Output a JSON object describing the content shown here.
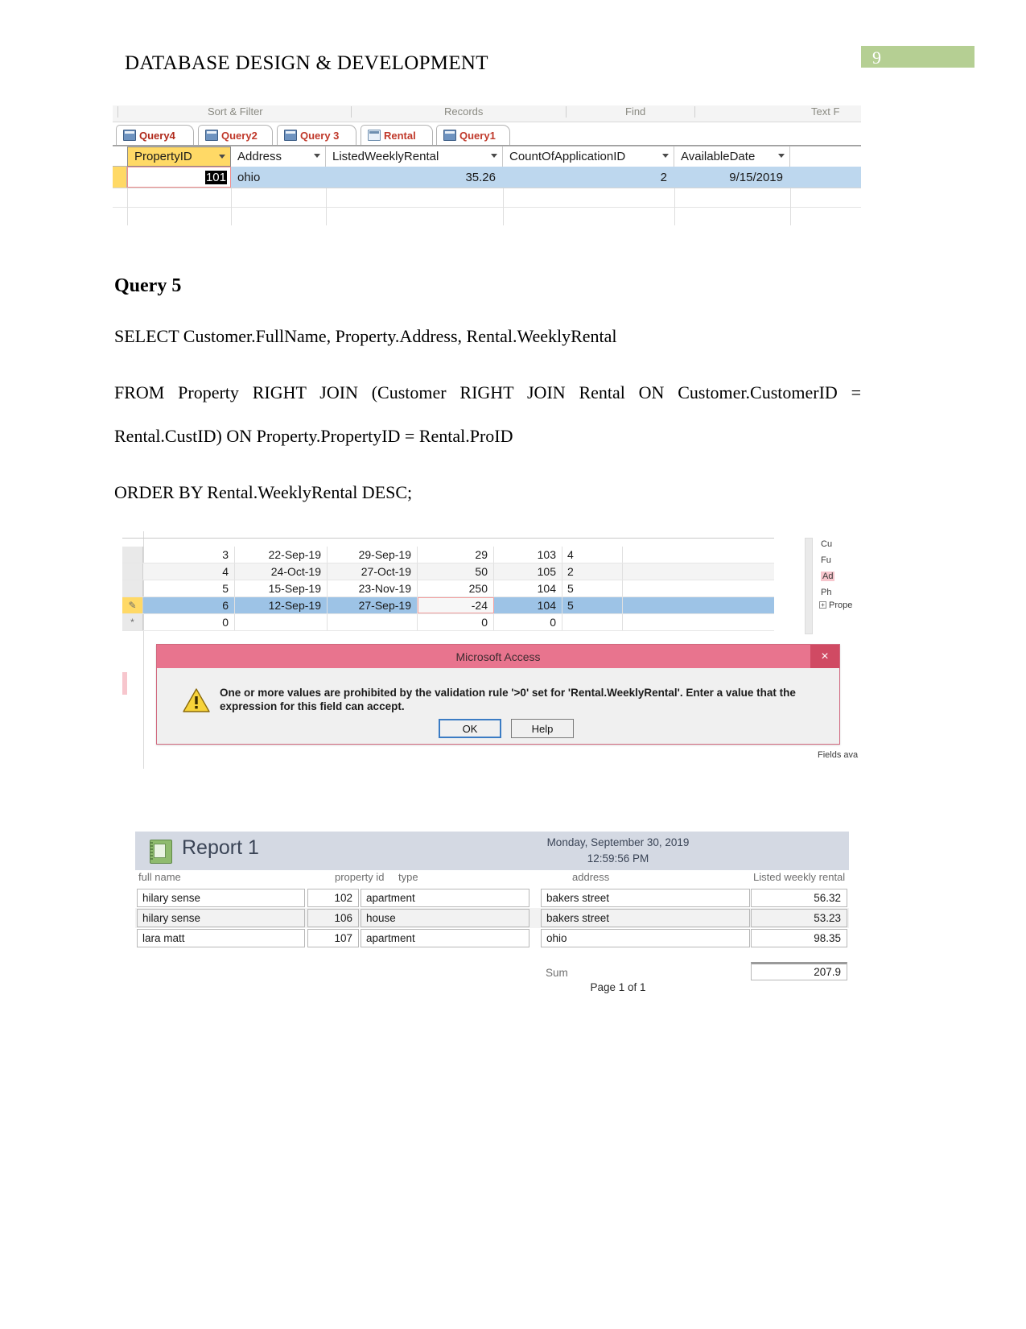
{
  "header": {
    "title": "DATABASE DESIGN & DEVELOPMENT",
    "page_number": "9",
    "accent_color": "#b5cf93"
  },
  "screenshot_query4": {
    "ribbon_groups": [
      "Sort & Filter",
      "Records",
      "Find",
      "Text F"
    ],
    "tabs": [
      {
        "label": "Query4",
        "icon": "query-icon",
        "active": true
      },
      {
        "label": "Query2",
        "icon": "query-icon",
        "active": false
      },
      {
        "label": "Query 3",
        "icon": "query-icon",
        "active": false
      },
      {
        "label": "Rental",
        "icon": "table-icon",
        "active": false
      },
      {
        "label": "Query1",
        "icon": "query-icon",
        "active": false
      }
    ],
    "columns": [
      "PropertyID",
      "Address",
      "ListedWeeklyRental",
      "CountOfApplicationID",
      "AvailableDate"
    ],
    "rows": [
      {
        "PropertyID": "101",
        "Address": "ohio",
        "ListedWeeklyRental": "35.26",
        "CountOfApplicationID": "2",
        "AvailableDate": "9/15/2019"
      }
    ]
  },
  "body": {
    "heading": "Query 5",
    "sql_line1": "SELECT Customer.FullName, Property.Address, Rental.WeeklyRental",
    "sql_line2a": "FROM Property RIGHT JOIN (Customer RIGHT JOIN Rental ON Customer.CustomerID =",
    "sql_line2b": "Rental.CustID) ON Property.PropertyID = Rental.ProID",
    "sql_line3": "ORDER BY Rental.WeeklyRental DESC;"
  },
  "screenshot_validation": {
    "grid_rows": [
      {
        "id": "3",
        "start": "22-Sep-19",
        "end": "29-Sep-19",
        "rent": "29",
        "prop": "103",
        "cust": "4",
        "selected": false,
        "alt": false,
        "invalid": false
      },
      {
        "id": "4",
        "start": "24-Oct-19",
        "end": "27-Oct-19",
        "rent": "50",
        "prop": "105",
        "cust": "2",
        "selected": false,
        "alt": true,
        "invalid": false
      },
      {
        "id": "5",
        "start": "15-Sep-19",
        "end": "23-Nov-19",
        "rent": "250",
        "prop": "104",
        "cust": "5",
        "selected": false,
        "alt": false,
        "invalid": false
      },
      {
        "id": "6",
        "start": "12-Sep-19",
        "end": "27-Sep-19",
        "rent": "-24",
        "prop": "104",
        "cust": "5",
        "selected": true,
        "alt": false,
        "invalid": true
      },
      {
        "id": "0",
        "start": "",
        "end": "",
        "rent": "0",
        "prop": "0",
        "cust": "",
        "selected": false,
        "alt": false,
        "invalid": false
      }
    ],
    "new_record_marker": "*",
    "right_panel": [
      "Cu",
      "Fu",
      "Ad",
      "Ph",
      "Prope"
    ],
    "right_panel_footer": "Fields ava",
    "dialog": {
      "title": "Microsoft Access",
      "close_label": "×",
      "message": "One or more values are prohibited by the validation rule '>0' set for 'Rental.WeeklyRental'. Enter a value that the expression for this field can accept.",
      "ok_label": "OK",
      "help_label": "Help",
      "title_bar_color": "#e8748e"
    }
  },
  "screenshot_report": {
    "title": "Report 1",
    "date": "Monday, September 30, 2019",
    "time": "12:59:56 PM",
    "columns": [
      "full name",
      "property id",
      "type",
      "address",
      "Listed weekly rental"
    ],
    "rows": [
      {
        "full_name": "hilary sense",
        "property_id": "102",
        "type": "apartment",
        "address": "bakers street",
        "rental": "56.32"
      },
      {
        "full_name": "hilary sense",
        "property_id": "106",
        "type": "house",
        "address": "bakers street",
        "rental": "53.23"
      },
      {
        "full_name": "lara matt",
        "property_id": "107",
        "type": "apartment",
        "address": "ohio",
        "rental": "98.35"
      }
    ],
    "sum_label": "Sum",
    "sum_value": "207.9",
    "page_footer": "Page 1 of 1"
  }
}
